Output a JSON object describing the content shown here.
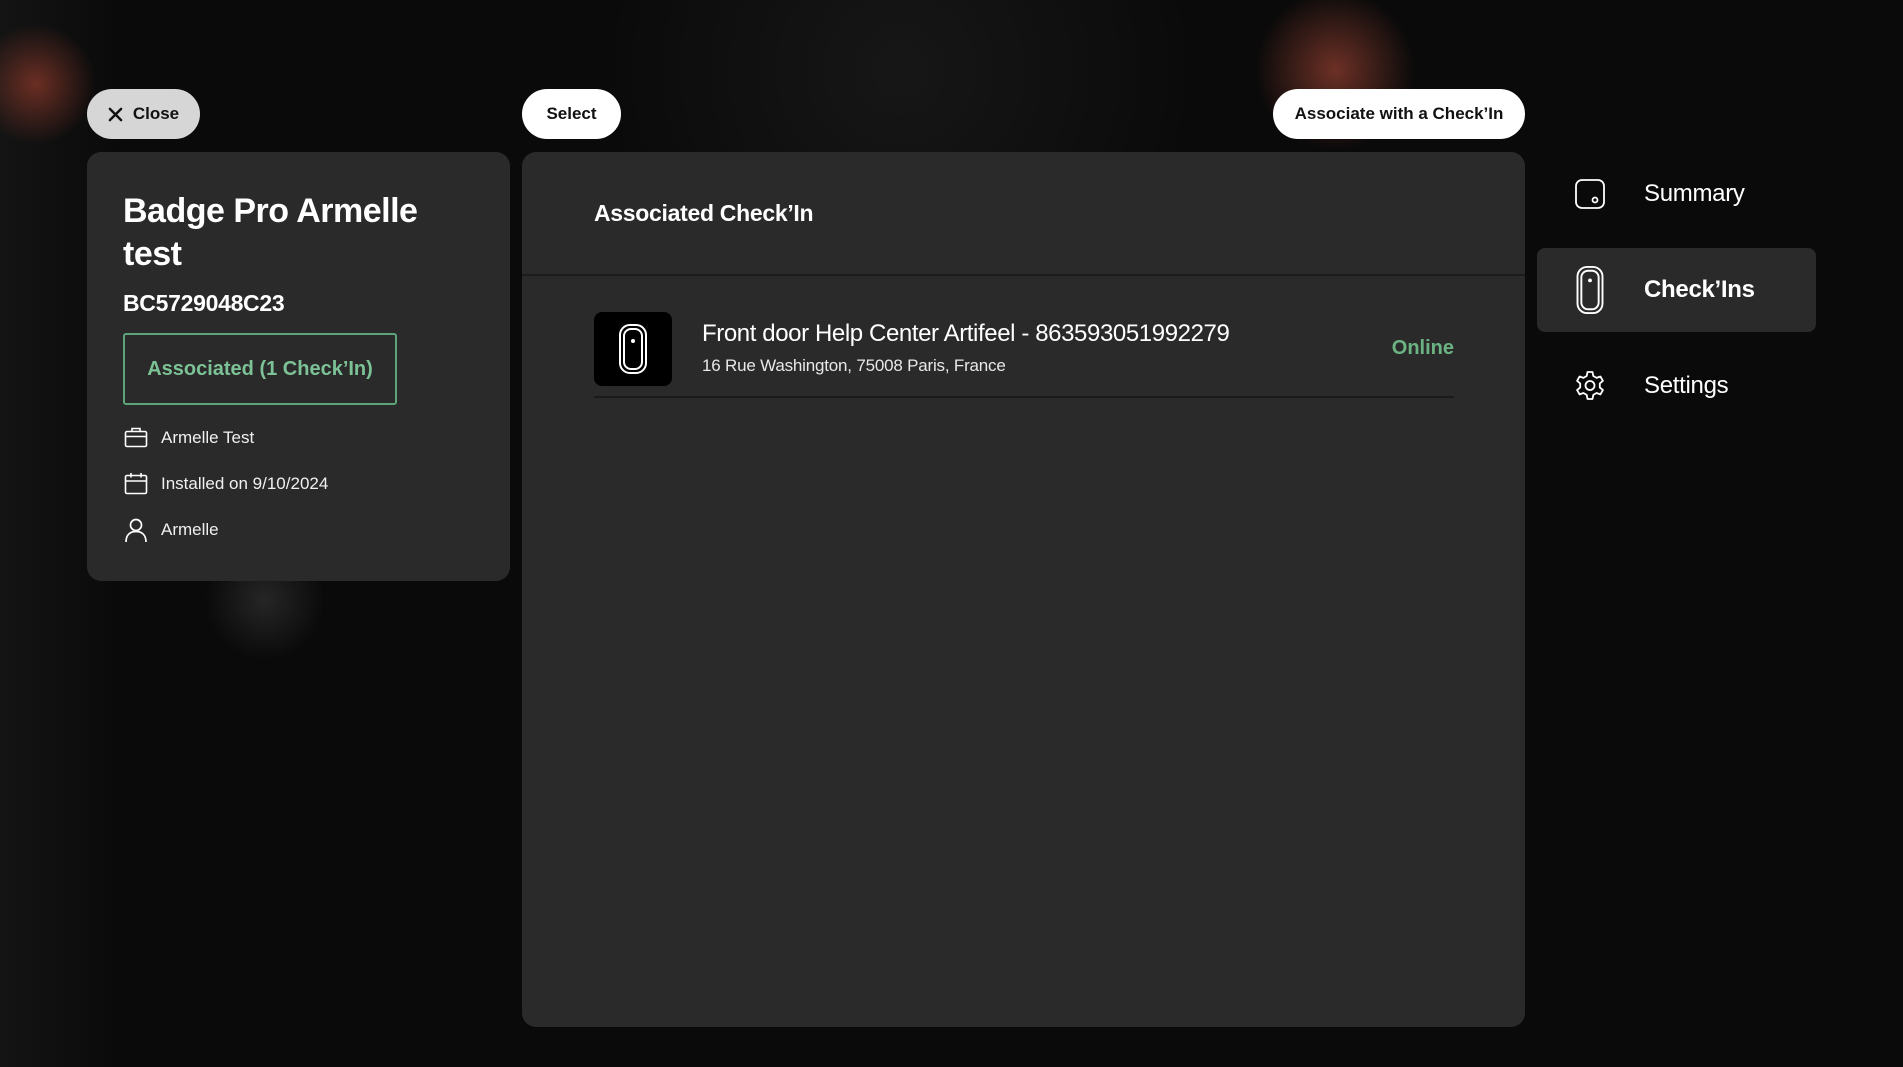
{
  "actions": {
    "close_label": "Close",
    "select_label": "Select",
    "associate_label": "Associate with a Check’In"
  },
  "badge": {
    "title": "Badge Pro Armelle test",
    "serial": "BC5729048C23",
    "association_status": "Associated (1 Check’In)",
    "company": "Armelle Test",
    "installed": "Installed on 9/10/2024",
    "user": "Armelle"
  },
  "panel": {
    "title": "Associated Check’In",
    "checkins": [
      {
        "name": "Front door Help Center Artifeel - 863593051992279",
        "address": "16 Rue Washington, 75008 Paris, France",
        "status": "Online",
        "icon": "checkin-device-icon"
      }
    ]
  },
  "nav": {
    "items": [
      {
        "label": "Summary",
        "icon": "badge-device-icon",
        "active": false
      },
      {
        "label": "Check’Ins",
        "icon": "checkin-device-icon",
        "active": true
      },
      {
        "label": "Settings",
        "icon": "gear-icon",
        "active": false
      }
    ]
  },
  "colors": {
    "accent_green": "#6cb383",
    "card_bg": "#2a2a2a",
    "page_bg": "#0b0b0b"
  }
}
